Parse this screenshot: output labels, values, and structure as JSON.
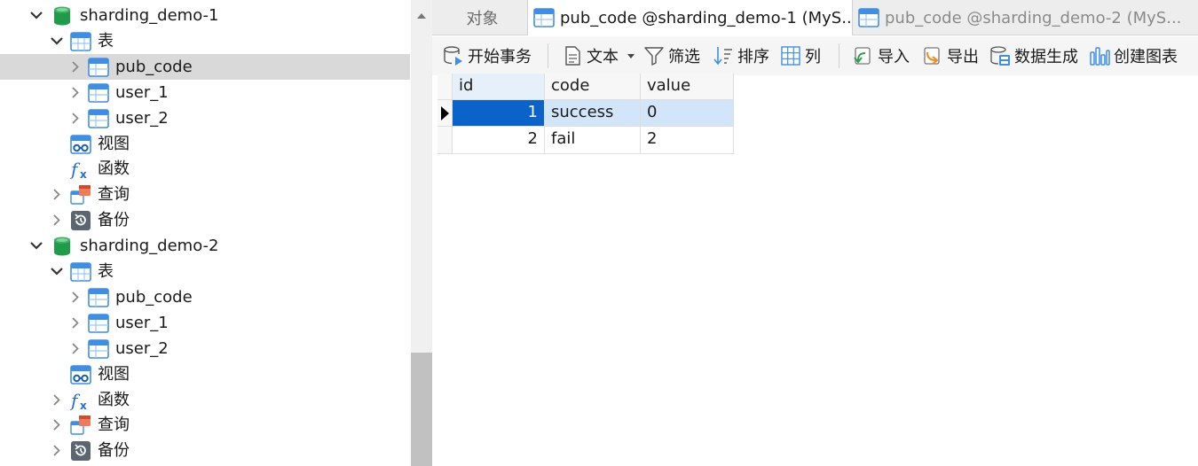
{
  "tree": {
    "items": [
      {
        "label": "sharding_demo-1",
        "kind": "database",
        "level": 0,
        "arrow": "expanded",
        "selected": false,
        "icon": "database-icon"
      },
      {
        "label": "表",
        "kind": "tables-folder",
        "level": 1,
        "arrow": "expanded",
        "selected": false,
        "icon": "tables-folder-icon"
      },
      {
        "label": "pub_code",
        "kind": "table",
        "level": 2,
        "arrow": "collapsed",
        "selected": true,
        "icon": "table-icon"
      },
      {
        "label": "user_1",
        "kind": "table",
        "level": 2,
        "arrow": "collapsed",
        "selected": false,
        "icon": "table-icon"
      },
      {
        "label": "user_2",
        "kind": "table",
        "level": 2,
        "arrow": "collapsed",
        "selected": false,
        "icon": "table-icon"
      },
      {
        "label": "视图",
        "kind": "views-folder",
        "level": 1,
        "arrow": "none",
        "selected": false,
        "icon": "views-icon"
      },
      {
        "label": "函数",
        "kind": "functions-folder",
        "level": 1,
        "arrow": "none",
        "selected": false,
        "icon": "function-icon"
      },
      {
        "label": "查询",
        "kind": "queries-folder",
        "level": 1,
        "arrow": "collapsed",
        "selected": false,
        "icon": "query-icon"
      },
      {
        "label": "备份",
        "kind": "backups-folder",
        "level": 1,
        "arrow": "collapsed",
        "selected": false,
        "icon": "backup-icon"
      },
      {
        "label": "sharding_demo-2",
        "kind": "database",
        "level": 0,
        "arrow": "expanded",
        "selected": false,
        "icon": "database-icon"
      },
      {
        "label": "表",
        "kind": "tables-folder",
        "level": 1,
        "arrow": "expanded",
        "selected": false,
        "icon": "tables-folder-icon"
      },
      {
        "label": "pub_code",
        "kind": "table",
        "level": 2,
        "arrow": "collapsed",
        "selected": false,
        "icon": "table-icon"
      },
      {
        "label": "user_1",
        "kind": "table",
        "level": 2,
        "arrow": "collapsed",
        "selected": false,
        "icon": "table-icon"
      },
      {
        "label": "user_2",
        "kind": "table",
        "level": 2,
        "arrow": "collapsed",
        "selected": false,
        "icon": "table-icon"
      },
      {
        "label": "视图",
        "kind": "views-folder",
        "level": 1,
        "arrow": "none",
        "selected": false,
        "icon": "views-icon"
      },
      {
        "label": "函数",
        "kind": "functions-folder",
        "level": 1,
        "arrow": "collapsed",
        "selected": false,
        "icon": "function-icon"
      },
      {
        "label": "查询",
        "kind": "queries-folder",
        "level": 1,
        "arrow": "collapsed",
        "selected": false,
        "icon": "query-icon"
      },
      {
        "label": "备份",
        "kind": "backups-folder",
        "level": 1,
        "arrow": "collapsed",
        "selected": false,
        "icon": "backup-icon"
      }
    ]
  },
  "tabs": {
    "objects": "对象",
    "active": "pub_code @sharding_demo-1 (MyS...",
    "inactive": "pub_code @sharding_demo-2 (MyS..."
  },
  "toolbar": {
    "begin_transaction": "开始事务",
    "text": "文本",
    "filter": "筛选",
    "sort": "排序",
    "columns": "列",
    "import": "导入",
    "export": "导出",
    "data_generation": "数据生成",
    "create_chart": "创建图表"
  },
  "grid": {
    "columns": [
      "id",
      "code",
      "value"
    ],
    "rows": [
      [
        "1",
        "success",
        "0"
      ],
      [
        "2",
        "fail",
        "2"
      ]
    ],
    "selected_row": 0
  },
  "colors": {
    "selection_blue": "#0a63c9",
    "row_highlight": "#d3e6f9",
    "db_green": "#1e9c4a",
    "table_blue": "#3d8ee6"
  }
}
